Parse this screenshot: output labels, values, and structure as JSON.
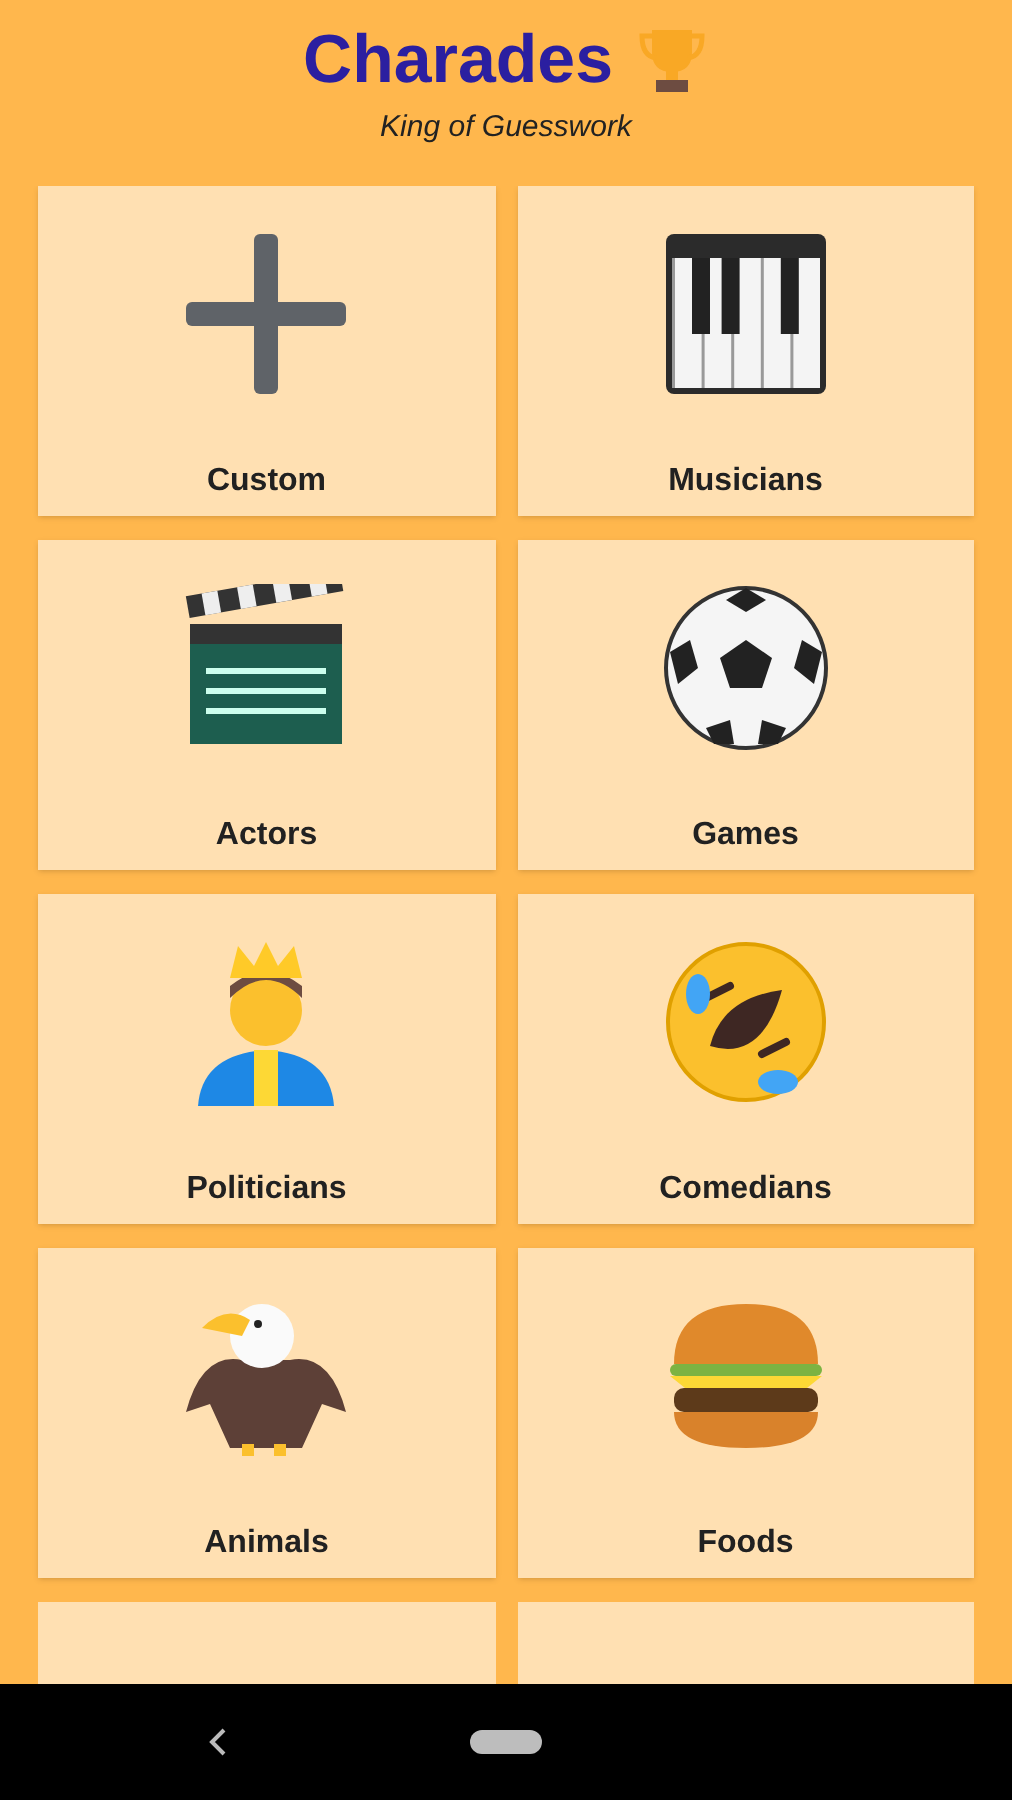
{
  "header": {
    "title": "Charades",
    "subtitle": "King of Guesswork"
  },
  "categories": [
    {
      "label": "Custom",
      "kind": "plus"
    },
    {
      "label": "Musicians",
      "kind": "piano"
    },
    {
      "label": "Actors",
      "kind": "clapper"
    },
    {
      "label": "Games",
      "kind": "ball"
    },
    {
      "label": "Politicians",
      "kind": "prince"
    },
    {
      "label": "Comedians",
      "kind": "laugh"
    },
    {
      "label": "Animals",
      "kind": "eagle"
    },
    {
      "label": "Foods",
      "kind": "burger"
    }
  ]
}
